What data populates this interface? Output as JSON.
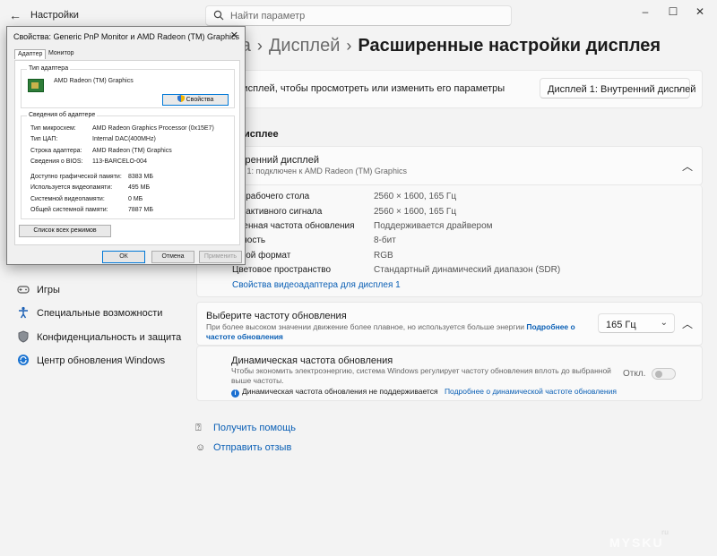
{
  "titlebar": {
    "app_title": "Настройки",
    "search_placeholder": "Найти параметр"
  },
  "breadcrumb": {
    "part1": "ма",
    "part2": "Дисплей",
    "current": "Расширенные настройки дисплея"
  },
  "select_display": {
    "label": "дисплей, чтобы просмотреть или изменить его параметры",
    "value": "Дисплей 1: Внутренний дисплей"
  },
  "section_title": "дисплее",
  "display_card": {
    "title": "утренний дисплей",
    "subtitle": "ей 1: подключен к AMD Radeon (TM) Graphics",
    "rows": [
      {
        "label": "им рабочего стола",
        "value": "2560 × 1600, 165 Гц"
      },
      {
        "label": "им активного сигнала",
        "value": "2560 × 1600, 165 Гц"
      },
      {
        "label": "еменная частота обновления",
        "value": "Поддерживается драйвером"
      },
      {
        "label": "ядность",
        "value": "8-бит"
      },
      {
        "label": "товой формат",
        "value": "RGB"
      },
      {
        "label": "Цветовое пространство",
        "value": "Стандартный динамический диапазон (SDR)"
      }
    ],
    "adapter_link": "Свойства видеоадаптера для дисплея 1"
  },
  "refresh": {
    "title": "Выберите частоту обновления",
    "desc": "При более высоком значении движение более плавное, но используется больше энергии",
    "more_link": "Подробнее о частоте обновления",
    "value": "165 Гц"
  },
  "dynamic": {
    "title": "Динамическая частота обновления",
    "desc": "Чтобы экономить электроэнергию, система Windows регулирует частоту обновления вплоть до выбранной выше частоты.",
    "toggle_label": "Откл.",
    "note": "Динамическая частота обновления не поддерживается",
    "note_link": "Подробнее о динамической частоте обновления"
  },
  "help": {
    "get_help": "Получить помощь",
    "feedback": "Отправить отзыв"
  },
  "sidebar": {
    "items": [
      {
        "label": "Игры",
        "icon": "gamepad-icon"
      },
      {
        "label": "Специальные возможности",
        "icon": "accessibility-icon"
      },
      {
        "label": "Конфиденциальность и защита",
        "icon": "shield-icon"
      },
      {
        "label": "Центр обновления Windows",
        "icon": "sync-icon"
      }
    ]
  },
  "dialog": {
    "title": "Свойства: Generic PnP Monitor и AMD Radeon (TM) Graphics",
    "tab_adapter": "Адаптер",
    "tab_monitor": "Монитор",
    "group_adapter_type": "Тип адаптера",
    "adapter_name": "AMD Radeon (TM) Graphics",
    "properties_btn": "Свойства",
    "group_info": "Сведения об адаптере",
    "info": [
      {
        "k": "Тип микросхем:",
        "v": "AMD Radeon Graphics Processor (0x15E7)"
      },
      {
        "k": "Тип ЦАП:",
        "v": "Internal DAC(400MHz)"
      },
      {
        "k": "Строка адаптера:",
        "v": "AMD Radeon (TM) Graphics"
      },
      {
        "k": "Сведения о BIOS:",
        "v": "113-BARCELO-004"
      }
    ],
    "memory": [
      {
        "k": "Доступно графической памяти:",
        "v": "8383 МБ"
      },
      {
        "k": "Используется видеопамяти:",
        "v": "495 МБ"
      },
      {
        "k": "Системной видеопамяти:",
        "v": "0 МБ"
      },
      {
        "k": "Общей системной памяти:",
        "v": "7887 МБ"
      }
    ],
    "list_modes_btn": "Список всех режимов",
    "ok": "ОК",
    "cancel": "Отмена",
    "apply": "Применить"
  },
  "watermark": {
    "text": "MYSKU",
    "sub": "ru"
  },
  "colors": {
    "accent": "#0a5fb5",
    "background": "#f3f3f3",
    "card": "#fbfbfb"
  }
}
